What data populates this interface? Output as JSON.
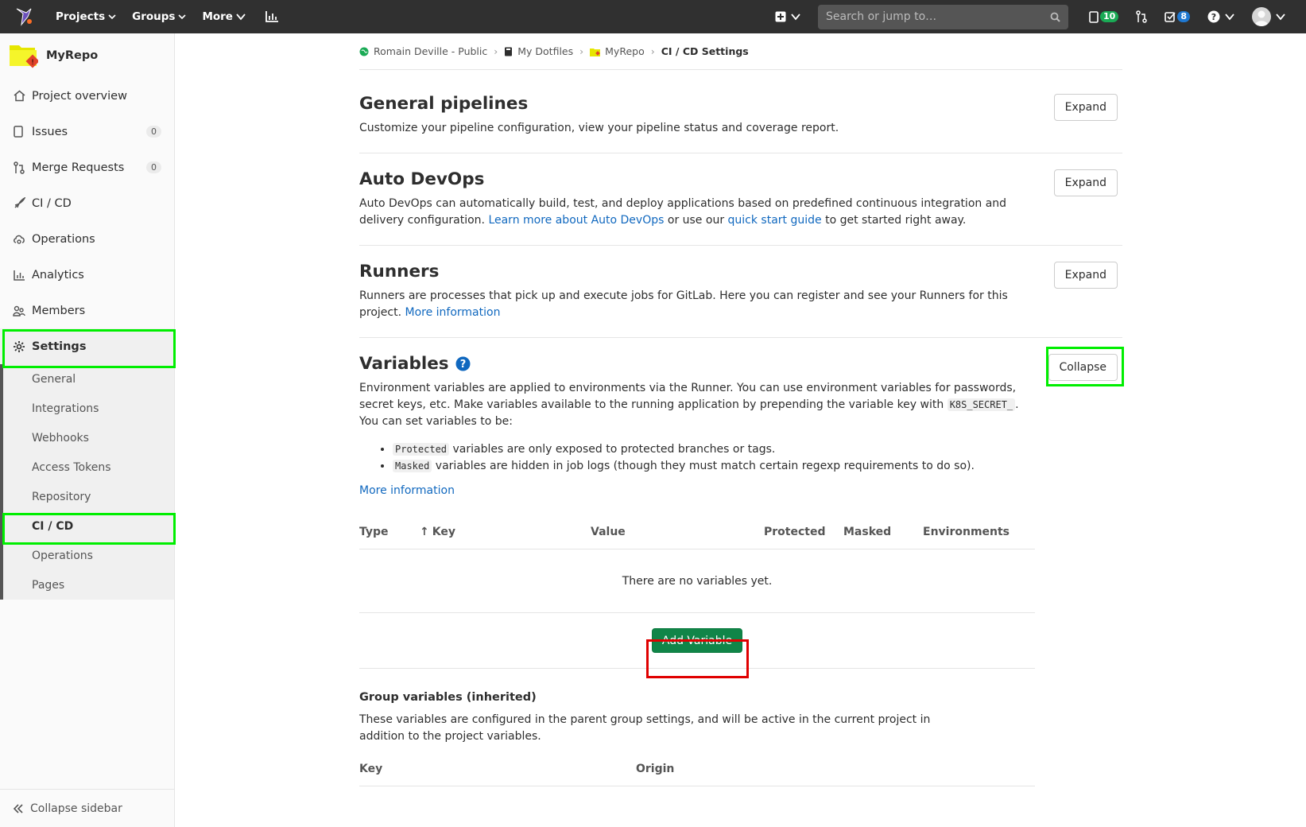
{
  "navbar": {
    "projects": "Projects",
    "groups": "Groups",
    "more": "More",
    "search_placeholder": "Search or jump to…",
    "issues_count": "10",
    "todos_count": "8"
  },
  "sidebar": {
    "project_name": "MyRepo",
    "items": [
      {
        "label": "Project overview"
      },
      {
        "label": "Issues",
        "count": "0"
      },
      {
        "label": "Merge Requests",
        "count": "0"
      },
      {
        "label": "CI / CD"
      },
      {
        "label": "Operations"
      },
      {
        "label": "Analytics"
      },
      {
        "label": "Members"
      },
      {
        "label": "Settings"
      }
    ],
    "settings_sub": [
      {
        "label": "General"
      },
      {
        "label": "Integrations"
      },
      {
        "label": "Webhooks"
      },
      {
        "label": "Access Tokens"
      },
      {
        "label": "Repository"
      },
      {
        "label": "CI / CD"
      },
      {
        "label": "Operations"
      },
      {
        "label": "Pages"
      }
    ],
    "collapse_label": "Collapse sidebar"
  },
  "breadcrumb": {
    "owner": "Romain Deville - Public",
    "group": "My Dotfiles",
    "project": "MyRepo",
    "current": "CI / CD Settings"
  },
  "sections": {
    "general": {
      "title": "General pipelines",
      "desc": "Customize your pipeline configuration, view your pipeline status and coverage report.",
      "button": "Expand"
    },
    "autodevops": {
      "title": "Auto DevOps",
      "desc_1": "Auto DevOps can automatically build, test, and deploy applications based on predefined continuous integration and delivery configuration. ",
      "link_1": "Learn more about Auto DevOps",
      "desc_2": " or use our ",
      "link_2": "quick start guide",
      "desc_3": " to get started right away.",
      "button": "Expand"
    },
    "runners": {
      "title": "Runners",
      "desc": "Runners are processes that pick up and execute jobs for GitLab. Here you can register and see your Runners for this project. ",
      "link": "More information",
      "button": "Expand"
    },
    "variables": {
      "title": "Variables",
      "desc_1": "Environment variables are applied to environments via the Runner. You can use environment variables for passwords, secret keys, etc. Make variables available to the running application by prepending the variable key with ",
      "code": "K8S_SECRET_",
      "desc_2": ". You can set variables to be:",
      "bullet_1_code": "Protected",
      "bullet_1_text": " variables are only exposed to protected branches or tags.",
      "bullet_2_code": "Masked",
      "bullet_2_text": " variables are hidden in job logs (though they must match certain regexp requirements to do so).",
      "more_link": "More information",
      "button": "Collapse",
      "table_headers": [
        "Type",
        "Key",
        "Value",
        "Protected",
        "Masked",
        "Environments"
      ],
      "empty_text": "There are no variables yet.",
      "add_button": "Add Variable",
      "group_title": "Group variables (inherited)",
      "group_desc": "These variables are configured in the parent group settings, and will be active in the current project in addition to the project variables.",
      "group_headers": [
        "Key",
        "Origin"
      ]
    }
  }
}
